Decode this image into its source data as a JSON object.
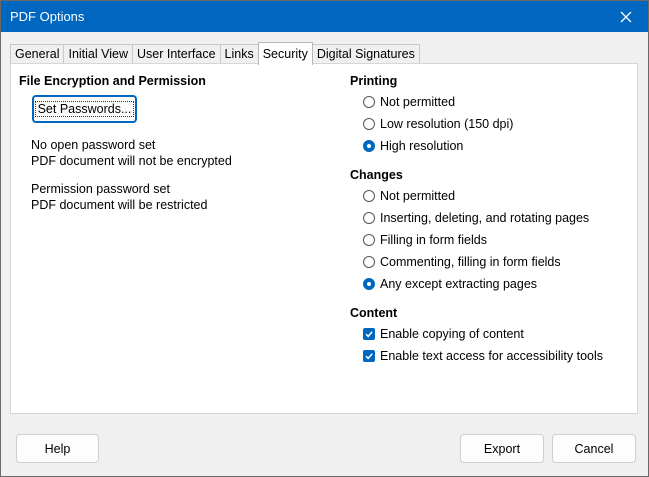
{
  "window": {
    "title": "PDF Options"
  },
  "tabs": [
    {
      "label": "General"
    },
    {
      "label": "Initial View"
    },
    {
      "label": "User Interface"
    },
    {
      "label": "Links"
    },
    {
      "label": "Security"
    },
    {
      "label": "Digital Signatures"
    }
  ],
  "active_tab": "Security",
  "encryption": {
    "title": "File Encryption and Permission",
    "set_passwords_label": "Set Passwords...",
    "open_status": "No open password set",
    "open_detail": "PDF document will not be encrypted",
    "perm_status": "Permission password set",
    "perm_detail": "PDF document will be restricted"
  },
  "printing": {
    "title": "Printing",
    "options": [
      {
        "label": "Not permitted",
        "selected": false
      },
      {
        "label": "Low resolution (150 dpi)",
        "selected": false
      },
      {
        "label": "High resolution",
        "selected": true
      }
    ]
  },
  "changes": {
    "title": "Changes",
    "options": [
      {
        "label": "Not permitted",
        "selected": false
      },
      {
        "label": "Inserting, deleting, and rotating pages",
        "selected": false
      },
      {
        "label": "Filling in form fields",
        "selected": false
      },
      {
        "label": "Commenting, filling in form fields",
        "selected": false
      },
      {
        "label": "Any except extracting pages",
        "selected": true
      }
    ]
  },
  "content": {
    "title": "Content",
    "options": [
      {
        "label": "Enable copying of content",
        "checked": true
      },
      {
        "label": "Enable text access for accessibility tools",
        "checked": true
      }
    ]
  },
  "footer": {
    "help_label": "Help",
    "export_label": "Export",
    "cancel_label": "Cancel"
  },
  "colors": {
    "accent": "#0067c0",
    "titlebar": "#0067c0"
  },
  "icons": {
    "close": "close-icon",
    "radio": "radio-icon",
    "checkbox": "checkmark-icon"
  }
}
